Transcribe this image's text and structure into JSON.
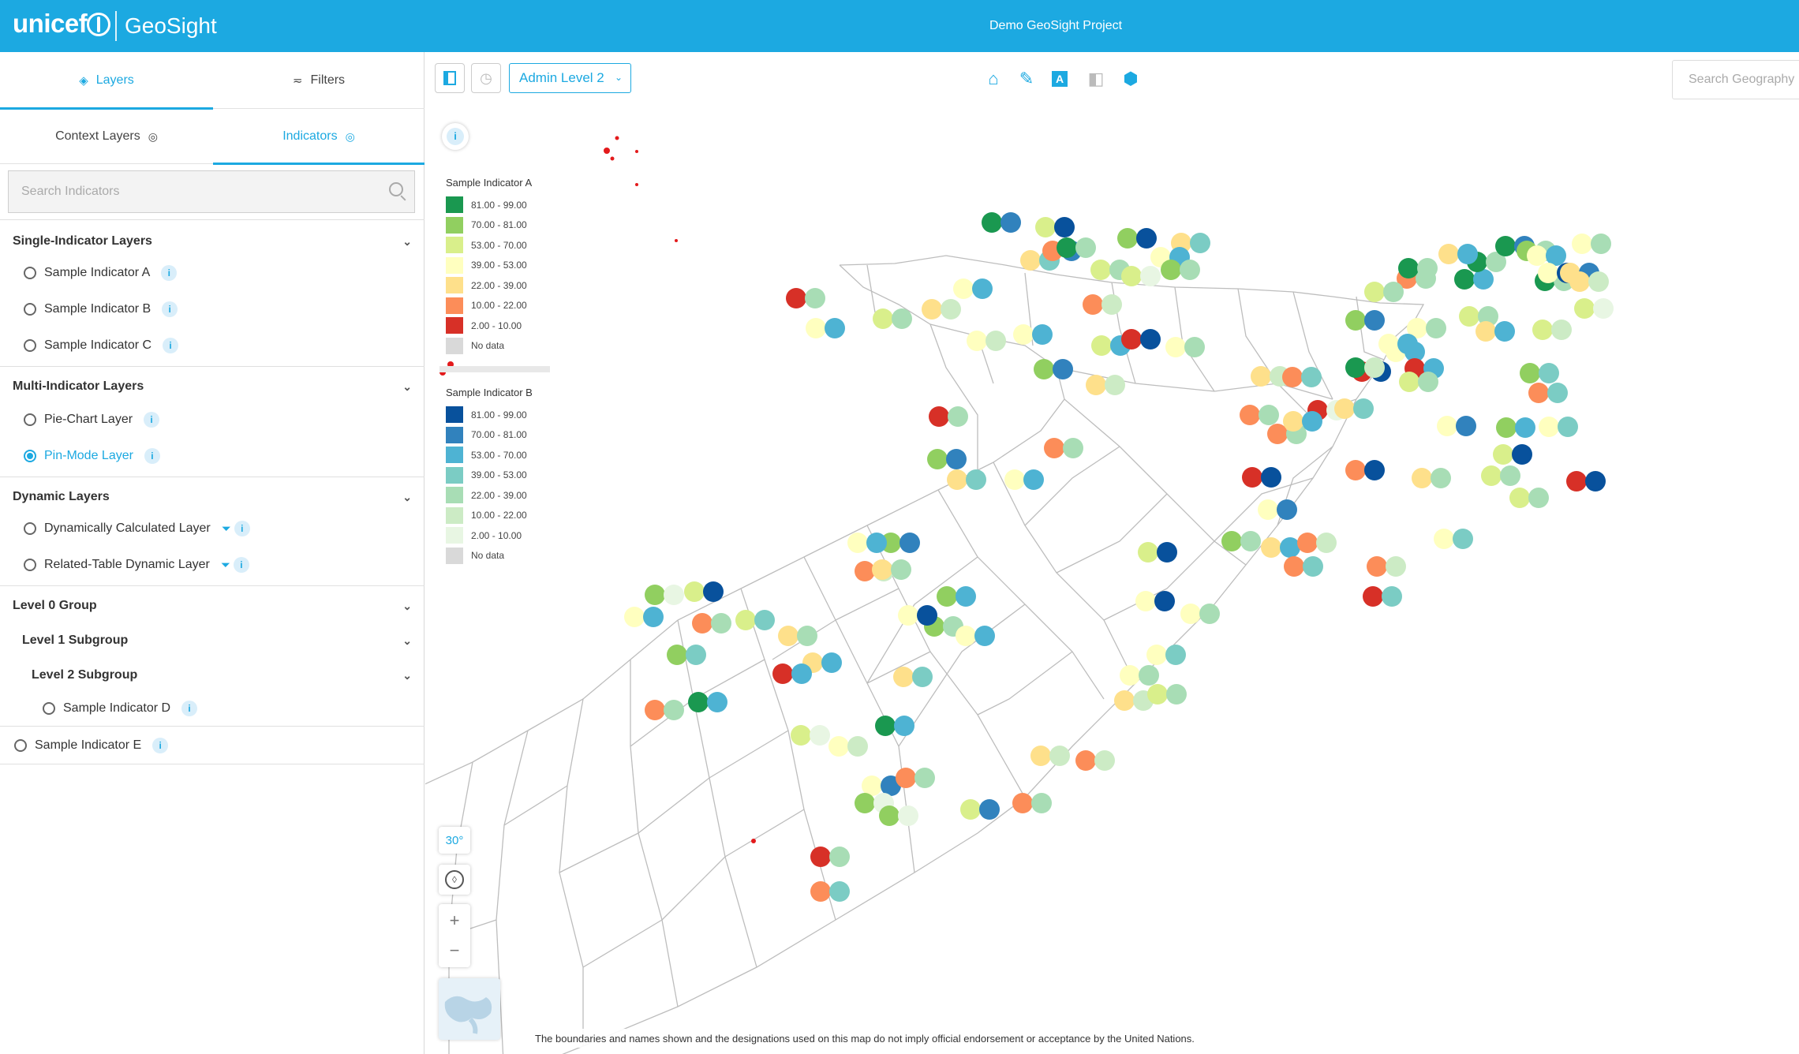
{
  "header": {
    "logo_text": "unicef",
    "app_name": "GeoSight",
    "project_title": "Demo GeoSight Project"
  },
  "sidebar": {
    "main_tabs": [
      {
        "label": "Layers",
        "icon": "layers-icon",
        "active": true
      },
      {
        "label": "Filters",
        "icon": "filter-icon",
        "active": false
      }
    ],
    "sub_tabs": [
      {
        "label": "Context Layers",
        "icon": "eye-icon",
        "active": false
      },
      {
        "label": "Indicators",
        "icon": "eye-icon",
        "active": true
      }
    ],
    "search_placeholder": "Search Indicators",
    "groups": [
      {
        "label": "Single-Indicator Layers",
        "items": [
          {
            "label": "Sample Indicator A"
          },
          {
            "label": "Sample Indicator B"
          },
          {
            "label": "Sample Indicator C"
          }
        ]
      },
      {
        "label": "Multi-Indicator Layers",
        "items": [
          {
            "label": "Pie-Chart Layer",
            "checked": false
          },
          {
            "label": "Pin-Mode Layer",
            "checked": true
          }
        ]
      },
      {
        "label": "Dynamic Layers",
        "items": [
          {
            "label": "Dynamically Calculated Layer"
          },
          {
            "label": "Related-Table Dynamic Layer"
          }
        ]
      },
      {
        "label": "Level 0 Group",
        "subgroup": {
          "label": "Level 1 Subgroup",
          "subgroup": {
            "label": "Level 2 Subgroup",
            "items": [
              {
                "label": "Sample Indicator D"
              }
            ]
          }
        }
      }
    ],
    "ungrouped_item": {
      "label": "Sample Indicator E"
    }
  },
  "toolbar": {
    "admin_level": "Admin Level 2",
    "tools": [
      "home-icon",
      "ruler-icon",
      "label-icon",
      "compare-icon",
      "3d-icon"
    ],
    "geo_search_placeholder": "Search Geography"
  },
  "legend": [
    {
      "title": "Sample Indicator A",
      "items": [
        {
          "label": "81.00 - 99.00",
          "color": "#1a9850"
        },
        {
          "label": "70.00 - 81.00",
          "color": "#91cf60"
        },
        {
          "label": "53.00 - 70.00",
          "color": "#d9ef8b"
        },
        {
          "label": "39.00 - 53.00",
          "color": "#ffffbf"
        },
        {
          "label": "22.00 - 39.00",
          "color": "#fee08b"
        },
        {
          "label": "10.00 - 22.00",
          "color": "#fc8d59"
        },
        {
          "label": "2.00 - 10.00",
          "color": "#d73027"
        },
        {
          "label": "No data",
          "color": "#d9d9d9"
        }
      ]
    },
    {
      "title": "Sample Indicator B",
      "items": [
        {
          "label": "81.00 - 99.00",
          "color": "#08519c"
        },
        {
          "label": "70.00 - 81.00",
          "color": "#3182bd"
        },
        {
          "label": "53.00 - 70.00",
          "color": "#4eb3d3"
        },
        {
          "label": "39.00 - 53.00",
          "color": "#7bccc4"
        },
        {
          "label": "22.00 - 39.00",
          "color": "#a8ddb5"
        },
        {
          "label": "10.00 - 22.00",
          "color": "#ccebc5"
        },
        {
          "label": "2.00 - 10.00",
          "color": "#e8f6e3"
        },
        {
          "label": "No data",
          "color": "#d9d9d9"
        }
      ]
    }
  ],
  "map_controls": {
    "pitch": "30°",
    "zoom_in": "+",
    "zoom_out": "−"
  },
  "disclaimer": "The boundaries and names shown and the designations used on this map do not imply official endorsement or acceptance by the United Nations."
}
